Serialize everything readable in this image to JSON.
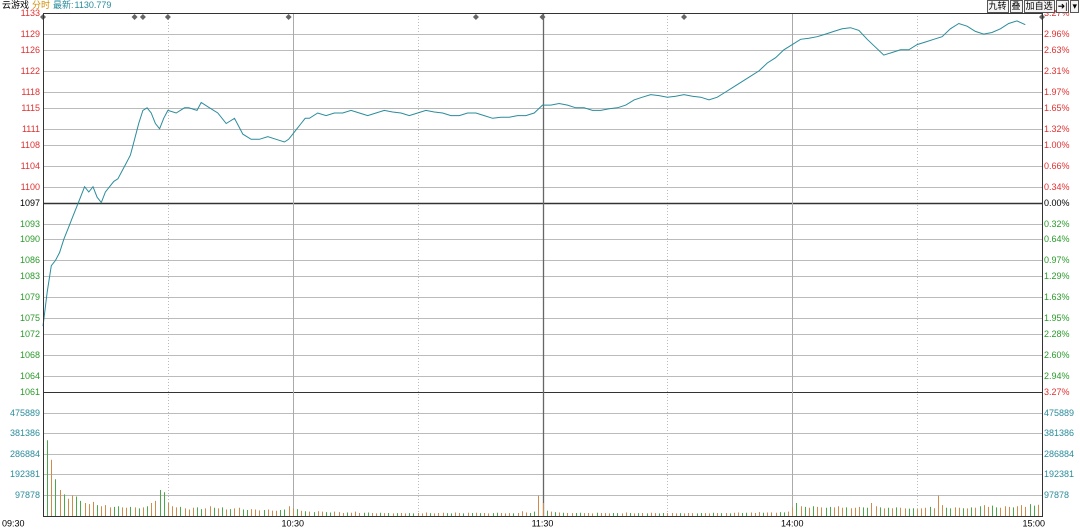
{
  "header": {
    "name": "云游戏",
    "mode": "分时",
    "latest_label": "最新:",
    "latest_value": "1130.779"
  },
  "toolbar": {
    "btn_jiuzhuan": "九转",
    "btn_stack": "叠",
    "btn_add": "加自选",
    "btn_pin": "➜|",
    "btn_menu": "▾"
  },
  "colors": {
    "price_line": "#2a8c9c",
    "up": "#e03030",
    "down": "#2a9a2a",
    "volume_label": "#2a8c9c",
    "grid": "#bbbbbb",
    "axis": "#000000"
  },
  "chart_data": {
    "type": "line",
    "title": "",
    "base_price": 1097,
    "ylim": [
      1061,
      1133
    ],
    "y_tick_labels_left": [
      "1133",
      "1129",
      "1126",
      "1122",
      "1118",
      "1115",
      "1111",
      "1108",
      "1104",
      "1100",
      "1097",
      "1093",
      "1090",
      "1086",
      "1083",
      "1079",
      "1075",
      "1072",
      "1068",
      "1064",
      "1061"
    ],
    "y_tick_values_left": [
      1133,
      1129,
      1126,
      1122,
      1118,
      1115,
      1111,
      1108,
      1104,
      1100,
      1097,
      1093,
      1090,
      1086,
      1083,
      1079,
      1075,
      1072,
      1068,
      1064,
      1061
    ],
    "y_tick_labels_right": [
      "3.27%",
      "2.96%",
      "2.63%",
      "2.31%",
      "1.97%",
      "1.65%",
      "1.32%",
      "1.00%",
      "0.66%",
      "0.34%",
      "0.00%",
      "0.32%",
      "0.64%",
      "0.97%",
      "1.29%",
      "1.63%",
      "1.95%",
      "2.28%",
      "2.60%",
      "2.94%",
      "3.27%"
    ],
    "x_labels": [
      "09:30",
      "10:30",
      "11:30",
      "14:00",
      "15:00"
    ],
    "x_label_minutes": [
      0,
      60,
      120,
      180,
      240
    ],
    "session_minutes": 240,
    "markers_minutes": [
      0,
      22,
      24,
      30,
      59,
      104,
      120,
      154,
      240
    ],
    "price_series": {
      "x": [
        0,
        1,
        2,
        3,
        4,
        5,
        6,
        7,
        8,
        9,
        10,
        11,
        12,
        13,
        14,
        15,
        16,
        17,
        18,
        19,
        20,
        21,
        22,
        23,
        24,
        25,
        26,
        27,
        28,
        29,
        30,
        32,
        34,
        35,
        37,
        38,
        40,
        42,
        44,
        46,
        48,
        50,
        52,
        54,
        56,
        58,
        59,
        60,
        61,
        62,
        63,
        64,
        66,
        68,
        70,
        72,
        74,
        76,
        78,
        80,
        82,
        84,
        86,
        88,
        90,
        92,
        94,
        96,
        98,
        100,
        102,
        104,
        106,
        108,
        110,
        112,
        114,
        116,
        118,
        120,
        122,
        124,
        126,
        128,
        130,
        132,
        134,
        136,
        138,
        140,
        142,
        144,
        146,
        148,
        150,
        152,
        154,
        156,
        158,
        160,
        162,
        164,
        166,
        168,
        170,
        172,
        174,
        176,
        178,
        180,
        182,
        184,
        186,
        188,
        190,
        192,
        194,
        196,
        198,
        200,
        202,
        204,
        206,
        208,
        210,
        212,
        214,
        216,
        218,
        220,
        222,
        224,
        226,
        228,
        230,
        232,
        234,
        236,
        238,
        240
      ],
      "y": [
        1073.5,
        1080,
        1085,
        1086,
        1087.5,
        1090,
        1092,
        1094,
        1096,
        1098,
        1100,
        1099,
        1100,
        1098,
        1097,
        1099,
        1100,
        1101,
        1101.5,
        1103,
        1104.5,
        1106,
        1109,
        1112,
        1114.5,
        1115,
        1114,
        1112,
        1111,
        1113,
        1114.5,
        1114,
        1115,
        1115,
        1114.5,
        1116,
        1115,
        1114,
        1112,
        1113,
        1110,
        1109,
        1109,
        1109.5,
        1109,
        1108.5,
        1109,
        1110,
        1111,
        1112,
        1113,
        1113,
        1114,
        1113.5,
        1114,
        1114,
        1114.5,
        1114,
        1113.5,
        1114,
        1114.5,
        1114.2,
        1114,
        1113.5,
        1114,
        1114.5,
        1114.2,
        1114,
        1113.5,
        1113.5,
        1114,
        1114,
        1113.5,
        1113,
        1113.2,
        1113.2,
        1113.5,
        1113.5,
        1114,
        1115.5,
        1115.5,
        1115.8,
        1115.5,
        1115,
        1115,
        1114.5,
        1114.5,
        1114.8,
        1115,
        1115.5,
        1116.5,
        1117,
        1117.5,
        1117.3,
        1117,
        1117.2,
        1117.5,
        1117.2,
        1117,
        1116.5,
        1117,
        1118,
        1119,
        1120,
        1121,
        1122,
        1123.5,
        1124.5,
        1126,
        1127,
        1128,
        1128.2,
        1128.5,
        1129,
        1129.5,
        1130,
        1130.2,
        1129.7,
        1128,
        1126.5,
        1125,
        1125.5,
        1126,
        1126,
        1127,
        1127.5,
        1128,
        1128.5,
        1130,
        1131,
        1130.5,
        1129.5,
        1129,
        1129.3,
        1130,
        1131,
        1131.5,
        1130.779
      ]
    },
    "volume": {
      "ylim": [
        0,
        573000
      ],
      "tick_labels": [
        "475889",
        "381386",
        "286884",
        "192381",
        "97878"
      ],
      "tick_values": [
        475889,
        381386,
        286884,
        192381,
        97878
      ],
      "minutes": [
        0,
        1,
        2,
        3,
        4,
        5,
        6,
        7,
        8,
        9,
        10,
        11,
        12,
        13,
        14,
        15,
        16,
        17,
        18,
        19,
        20,
        21,
        22,
        23,
        24,
        25,
        26,
        27,
        28,
        29,
        30,
        31,
        32,
        33,
        34,
        35,
        36,
        37,
        38,
        39,
        40,
        41,
        42,
        43,
        44,
        45,
        46,
        47,
        48,
        49,
        50,
        51,
        52,
        53,
        54,
        55,
        56,
        57,
        58,
        59,
        60,
        61,
        62,
        63,
        64,
        65,
        66,
        67,
        68,
        69,
        70,
        71,
        72,
        73,
        74,
        75,
        76,
        77,
        78,
        79,
        80,
        81,
        82,
        83,
        84,
        85,
        86,
        87,
        88,
        89,
        90,
        91,
        92,
        93,
        94,
        95,
        96,
        97,
        98,
        99,
        100,
        101,
        102,
        103,
        104,
        105,
        106,
        107,
        108,
        109,
        110,
        111,
        112,
        113,
        114,
        115,
        116,
        117,
        118,
        119,
        120,
        121,
        122,
        123,
        124,
        125,
        126,
        127,
        128,
        129,
        130,
        131,
        132,
        133,
        134,
        135,
        136,
        137,
        138,
        139,
        140,
        141,
        142,
        143,
        144,
        145,
        146,
        147,
        148,
        149,
        150,
        151,
        152,
        153,
        154,
        155,
        156,
        157,
        158,
        159,
        160,
        161,
        162,
        163,
        164,
        165,
        166,
        167,
        168,
        169,
        170,
        171,
        172,
        173,
        174,
        175,
        176,
        177,
        178,
        179,
        180,
        181,
        182,
        183,
        184,
        185,
        186,
        187,
        188,
        189,
        190,
        191,
        192,
        193,
        194,
        195,
        196,
        197,
        198,
        199,
        200,
        201,
        202,
        203,
        204,
        205,
        206,
        207,
        208,
        209,
        210,
        211,
        212,
        213,
        214,
        215,
        216,
        217,
        218,
        219,
        220,
        221,
        222,
        223,
        224,
        225,
        226,
        227,
        228,
        229,
        230,
        231,
        232,
        233,
        234,
        235,
        236,
        237,
        238,
        239,
        240
      ],
      "values": [
        570000,
        350000,
        260000,
        170000,
        120000,
        100000,
        80000,
        95000,
        90000,
        70000,
        60000,
        55000,
        65000,
        50000,
        45000,
        50000,
        40000,
        42000,
        45000,
        40000,
        38000,
        42000,
        40000,
        35000,
        40000,
        45000,
        60000,
        70000,
        120000,
        110000,
        60000,
        45000,
        40000,
        42000,
        35000,
        30000,
        38000,
        40000,
        32000,
        35000,
        45000,
        38000,
        35000,
        40000,
        30000,
        32000,
        35000,
        38000,
        30000,
        28000,
        32000,
        30000,
        26000,
        28000,
        30000,
        25000,
        24000,
        28000,
        30000,
        45000,
        35000,
        32000,
        24000,
        22000,
        20000,
        18000,
        22000,
        20000,
        18000,
        16000,
        20000,
        18000,
        14000,
        16000,
        15000,
        20000,
        14000,
        15000,
        16000,
        14000,
        12000,
        15000,
        13000,
        14000,
        12000,
        13000,
        14000,
        12000,
        13000,
        12000,
        14000,
        12000,
        16000,
        13000,
        12000,
        14000,
        15000,
        13000,
        12000,
        16000,
        14000,
        12000,
        15000,
        14000,
        15000,
        13000,
        14000,
        12000,
        13000,
        15000,
        14000,
        12000,
        13000,
        12000,
        14000,
        22000,
        16000,
        14000,
        20000,
        95000,
        60000,
        25000,
        20000,
        18000,
        16000,
        15000,
        14000,
        13000,
        14000,
        15000,
        13000,
        14000,
        12000,
        15000,
        14000,
        13000,
        12000,
        14000,
        13000,
        12000,
        16000,
        14000,
        12000,
        13000,
        14000,
        12000,
        15000,
        13000,
        12000,
        14000,
        13000,
        14000,
        12000,
        13000,
        12000,
        14000,
        13000,
        12000,
        14000,
        13000,
        12000,
        15000,
        14000,
        13000,
        14000,
        12000,
        15000,
        16000,
        14000,
        15000,
        16000,
        14000,
        18000,
        15000,
        16000,
        17000,
        15000,
        18000,
        17000,
        20000,
        40000,
        60000,
        45000,
        42000,
        38000,
        45000,
        42000,
        40000,
        38000,
        42000,
        40000,
        45000,
        38000,
        40000,
        36000,
        38000,
        42000,
        40000,
        38000,
        60000,
        45000,
        40000,
        35000,
        38000,
        36000,
        40000,
        38000,
        35000,
        34000,
        36000,
        32000,
        35000,
        38000,
        42000,
        36000,
        95000,
        50000,
        38000,
        35000,
        40000,
        38000,
        36000,
        35000,
        40000,
        38000,
        45000,
        50000,
        42000,
        48000,
        40000,
        38000,
        45000,
        42000,
        40000,
        45000,
        50000,
        42000,
        55000,
        48000,
        52000,
        60000,
        110000,
        140000
      ]
    }
  }
}
